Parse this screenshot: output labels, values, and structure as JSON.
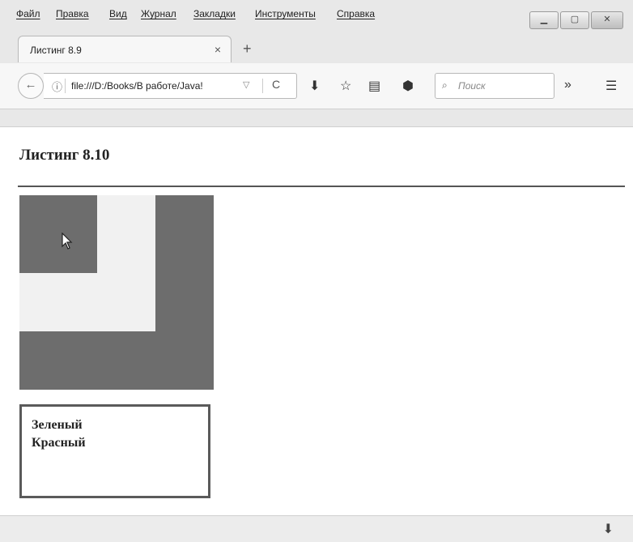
{
  "menu": {
    "items": [
      "Файл",
      "Правка",
      "Вид",
      "Журнал",
      "Закладки",
      "Инструменты",
      "Справка"
    ]
  },
  "tab": {
    "title": "Листинг 8.9",
    "close": "×",
    "new": "+"
  },
  "navbar": {
    "url": "file:///D:/Books/В работе/Java!",
    "search_placeholder": "Поиск",
    "icons": {
      "back": "←",
      "info": "ⓘ",
      "dropdown": "▽",
      "reload": "C",
      "download": "⬇",
      "bookmark": "☆",
      "library": "▤",
      "pocket": "⬢",
      "search": "🔍",
      "overflow": "»",
      "menu": "☰"
    }
  },
  "page": {
    "title": "Листинг 8.10",
    "log": [
      "Зеленый",
      "Красный"
    ]
  },
  "status": {
    "download_icon": "⬇"
  }
}
